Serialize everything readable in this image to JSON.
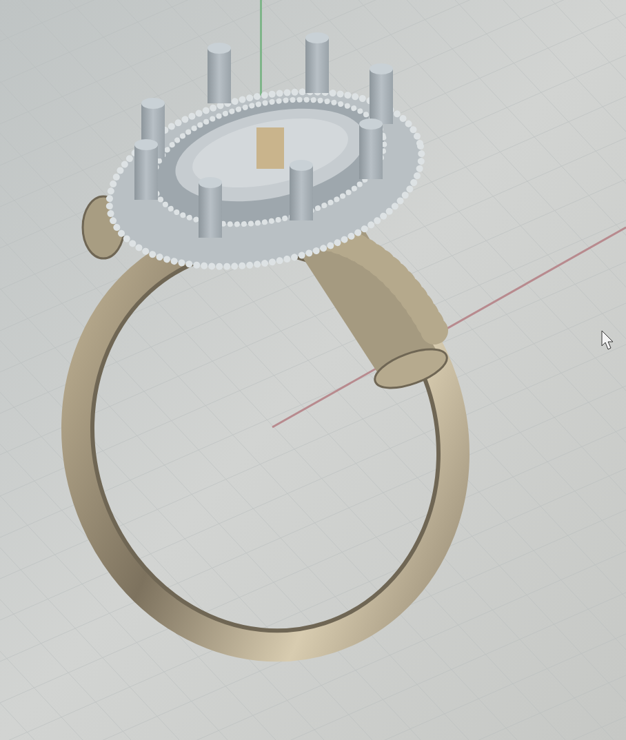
{
  "viewport": {
    "axes": [
      {
        "kind": "vertical",
        "color": "#7fb58a"
      },
      {
        "kind": "diagonal",
        "color": "#b88a8e"
      }
    ]
  }
}
